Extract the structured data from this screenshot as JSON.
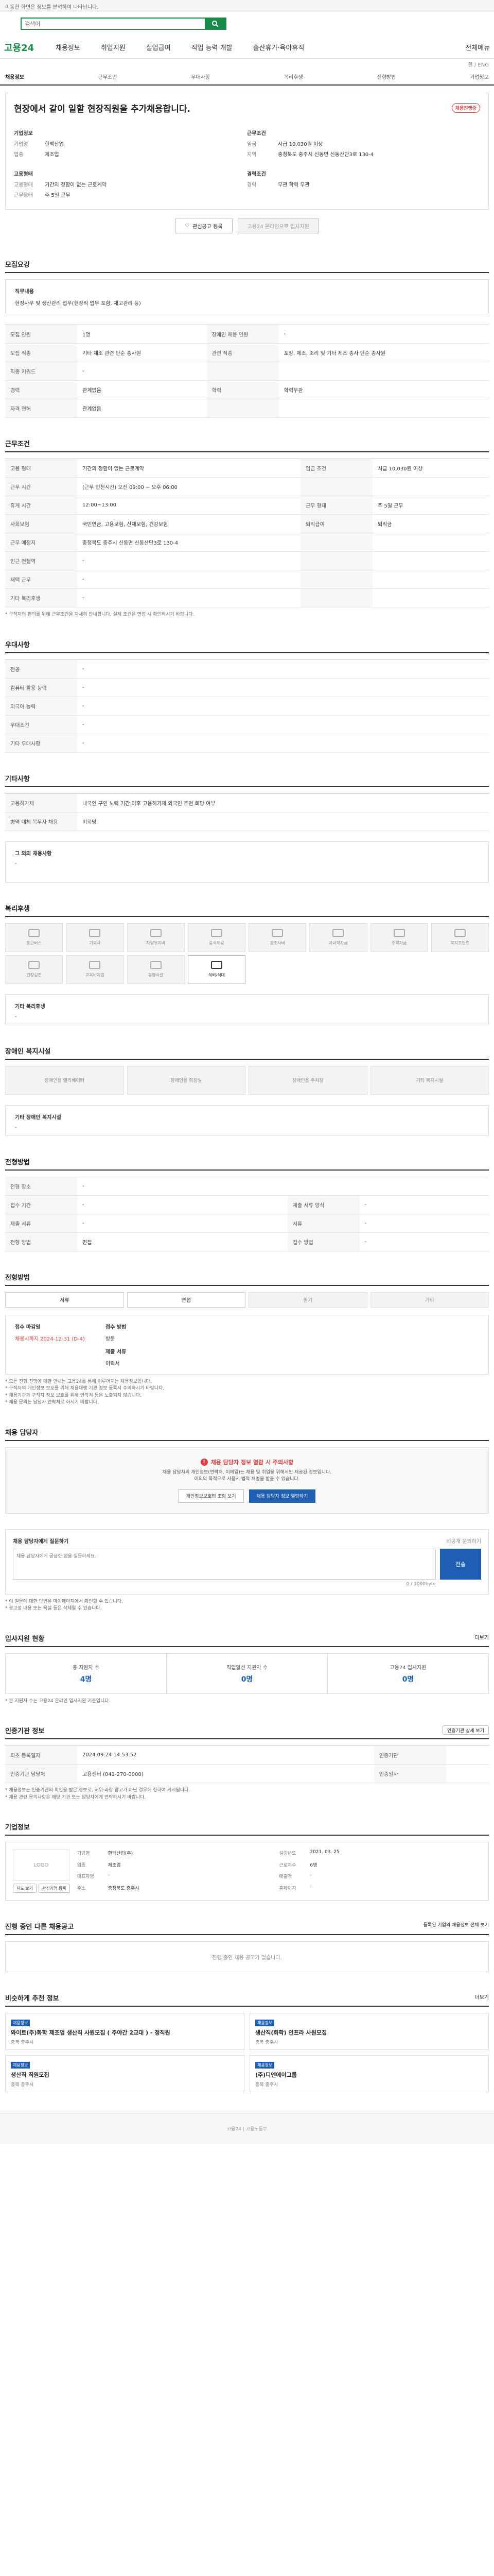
{
  "top": {
    "notice": "이동한 화면은 정보를 분석하여 나타납니다."
  },
  "search": {
    "placeholder": "검색어"
  },
  "gnb": {
    "logo": "고용24",
    "items": [
      "채용정보",
      "취업지원",
      "실업급여",
      "직업 능력 개발",
      "출산휴가·육아휴직"
    ],
    "right": "전체메뉴",
    "lang": "한 / ENG"
  },
  "subnav": [
    "채용정보",
    "근무조건",
    "우대사항",
    "복리후생",
    "전형방법",
    "기업정보"
  ],
  "header": {
    "title": "현장에서 같이 일할 현장직원을 추가채용합니다.",
    "badge": "채용진행중",
    "company_title": "기업정보",
    "company_rows": [
      {
        "k": "기업명",
        "v": "한백산업"
      },
      {
        "k": "업종",
        "v": "제조업"
      }
    ],
    "cond_title": "근무조건",
    "cond_rows": [
      {
        "k": "임금",
        "v": "시급 10,030원 이상"
      },
      {
        "k": "지역",
        "v": "충청북도 충주시 신동면 신동산단3로 130-4"
      }
    ],
    "emp_title": "고용형태",
    "emp_rows": [
      {
        "k": "고용형태",
        "v": "기간의 정함이 없는 근로계약"
      },
      {
        "k": "근무형태",
        "v": "주 5일 근무"
      }
    ],
    "career_title": "경력조건",
    "career_rows": [
      {
        "k": "경력",
        "v": "무관 학력 무관"
      }
    ],
    "btn_scrap": "관심공고 등록",
    "btn_apply": "고용24 온라인으로 입사지원"
  },
  "recruit": {
    "title": "모집요강",
    "duty_title": "직무내용",
    "duty_text": "현장사무 및 생산관리 업무(현장직 업무 포함, 재고관리 등)",
    "rows": [
      {
        "k": "모집 인원",
        "v": "1명",
        "k2": "장애인 채용 인원",
        "v2": "-"
      },
      {
        "k": "모집 직종",
        "v": "기타 제조 관련 단순 종사원",
        "k2": "관련 직종",
        "v2": "포장, 제조, 조리 및 기타 제조 종사 단순 종사원"
      },
      {
        "k": "직종 키워드",
        "v": "-",
        "k2": "",
        "v2": ""
      },
      {
        "k": "경력",
        "v": "관계없음",
        "k2": "학력",
        "v2": "학력무관"
      },
      {
        "k": "자격 면허",
        "v": "관계없음",
        "k2": "",
        "v2": ""
      }
    ]
  },
  "work": {
    "title": "근무조건",
    "rows": [
      {
        "k": "고용 형태",
        "v": "기간의 정함이 없는 근로계약",
        "k2": "임금 조건",
        "v2": "시급 10,030원 이상"
      },
      {
        "k": "근무 시간",
        "v": "(근무 인천시간) 오전 09:00 ~ 오후 06:00",
        "k2": "",
        "v2": ""
      },
      {
        "k": "휴게 시간",
        "v": "12:00~13:00",
        "k2": "근무 형태",
        "v2": "주 5일 근무"
      },
      {
        "k": "사회보험",
        "v": "국민연금, 고용보험, 산재보험, 건강보험",
        "k2": "퇴직급여",
        "v2": "퇴직금"
      },
      {
        "k": "근무 예정지",
        "v": "충청북도 충주시 신동면 신동산단3로 130-4",
        "k2": "",
        "v2": ""
      },
      {
        "k": "인근 전철역",
        "v": "-",
        "k2": "",
        "v2": ""
      },
      {
        "k": "재택 근무",
        "v": "-",
        "k2": "",
        "v2": ""
      },
      {
        "k": "기타 복리후생",
        "v": "-",
        "k2": "",
        "v2": ""
      }
    ],
    "note": "* 구직자의 편의를 위해 근무조건을 자세히 안내합니다. 실제 조건은 면접 시 확인하시기 바랍니다."
  },
  "pref": {
    "title": "우대사항",
    "rows": [
      {
        "k": "전공",
        "v": "-"
      },
      {
        "k": "컴퓨터 활용 능력",
        "v": "-"
      },
      {
        "k": "외국어 능력",
        "v": "-"
      },
      {
        "k": "우대조건",
        "v": "-"
      },
      {
        "k": "기타 우대사항",
        "v": "-"
      }
    ]
  },
  "other": {
    "title": "기타사항",
    "rows": [
      {
        "k": "고용허가제",
        "v": "내국인 구인 노력 기간 이후 고용허가제 외국인 추천 희망 여부"
      },
      {
        "k": "병역 대체 복무자 채용",
        "v": "비희망"
      }
    ],
    "sub_title": "그 외의 채용사항",
    "sub_text": "-"
  },
  "welfare": {
    "title": "복리후생",
    "items": [
      {
        "label": "통근버스",
        "on": false
      },
      {
        "label": "기숙사",
        "on": false
      },
      {
        "label": "차량유지비",
        "on": false
      },
      {
        "label": "중식제공",
        "on": false
      },
      {
        "label": "경조사비",
        "on": false
      },
      {
        "label": "자녀학자금",
        "on": false
      },
      {
        "label": "주택자금",
        "on": false
      },
      {
        "label": "복지포인트",
        "on": false
      },
      {
        "label": "건강검진",
        "on": false
      },
      {
        "label": "교육비지원",
        "on": false
      },
      {
        "label": "휴양시설",
        "on": false
      },
      {
        "label": "식비/식대",
        "on": true
      }
    ],
    "etc_title": "기타 복리후생",
    "etc_text": "-"
  },
  "disab": {
    "title": "장애인 복지시설",
    "items": [
      "장애인용 엘리베이터",
      "장애인용 화장실",
      "장애인용 주차장",
      "기타 복지시설"
    ],
    "etc_title": "기타 장애인 복지시설",
    "etc_text": "-"
  },
  "method": {
    "title": "전형방법",
    "rows": [
      {
        "k": "전형 장소",
        "v": "-"
      },
      {
        "k": "접수 기간",
        "v": "-",
        "k2": "제출 서류 양식",
        "v2": "-"
      },
      {
        "k": "제출 서류",
        "v": "-",
        "k2": "서류",
        "v2": "-"
      },
      {
        "k": "전형 방법",
        "v": "면접",
        "k2": "접수 방법",
        "v2": "-"
      }
    ]
  },
  "jeonhyeong": {
    "title": "전형방법",
    "items": [
      {
        "label": "서류",
        "off": false
      },
      {
        "label": "면접",
        "off": false
      },
      {
        "label": "필기",
        "off": true
      },
      {
        "label": "기타",
        "off": true
      }
    ],
    "deadline_title": "접수 마감일",
    "deadline": "채용시까지 2024-12-31 (D-4)",
    "apply_title": "접수 방법",
    "apply": "방문",
    "doc_title": "제출 서류",
    "doc": "이력서",
    "notes": [
      "* 모든 전형 진행에 대한 안내는 고용24를 통해 이루어지는 채용정보입니다.",
      "* 구직자의 개인정보 보호를 위해 채용대행 기관 정보 등록시 주의하시기 바랍니다.",
      "* 채용기관과 구직자 정보 보호를 위해 연락처 등은 노출되지 않습니다.",
      "* 채용 문의는 담당자 연락처로 하시기 바랍니다."
    ]
  },
  "contact": {
    "title": "채용 담당자",
    "alert": "채용 담당자 정보 열람 시 주의사항",
    "desc1": "채용 담당자의 개인정보(연락처, 이메일)는 채용 및 취업을 위해서만 제공된 정보입니다.",
    "desc2": "이외의 목적으로 사용시 법적 처벌을 받을 수 있습니다.",
    "btn1": "개인정보보호법 조항 보기",
    "btn2": "채용 담당자 정보 열람하기"
  },
  "inquiry": {
    "title": "채용 담당자에게 질문하기",
    "hint": "비공개 문의하기",
    "placeholder": "채용 담당자에게 궁금한 점을 질문하세요.",
    "send": "전송",
    "count": "0 / 1000byte",
    "notes": [
      "* 이 질문에 대한 답변은 마이페이지에서 확인할 수 있습니다.",
      "* 광고성 내용 또는 욕설 등은 삭제될 수 있습니다."
    ]
  },
  "status": {
    "title": "입사지원 현황",
    "more": "더보기",
    "items": [
      {
        "l": "총 지원자 수",
        "v": "4명"
      },
      {
        "l": "직업알선 지원자 수",
        "v": "0명"
      },
      {
        "l": "고용24 입사지원",
        "v": "0명"
      }
    ],
    "note": "* 본 지원자 수는 고용24 온라인 입사지원 기준입니다."
  },
  "agency": {
    "title": "인증기관 정보",
    "btn": "인증기관 상세 보기",
    "rows": [
      {
        "k": "최초 등록일자",
        "v": "2024.09.24 14:53:52",
        "k2": "인증기관",
        "v2": "",
        "k3": "",
        "v3": ""
      },
      {
        "k": "인증기관 담당처",
        "v": "고용센터 (041-270-0000)",
        "k2": "인증일자",
        "v2": "",
        "k3": "",
        "v3": ""
      }
    ],
    "notes": [
      "* 채용정보는 인증기관의 확인을 받은 정보로, 허위·과장 광고가 아닌 경우에 한하여 게시됩니다.",
      "* 채용 관련 문의사항은 해당 기관 또는 담당자에게 연락하시기 바랍니다."
    ]
  },
  "company": {
    "title": "기업정보",
    "logo": "LOGO",
    "btn1": "지도 보기",
    "btn2": "관심기업 등록",
    "fields": [
      {
        "k": "기업명",
        "v": "한백산업(주)"
      },
      {
        "k": "설립년도",
        "v": "2021. 03. 25"
      },
      {
        "k": "업종",
        "v": "제조업"
      },
      {
        "k": "근로자수",
        "v": "6명"
      },
      {
        "k": "대표자명",
        "v": "-"
      },
      {
        "k": "매출액",
        "v": "-"
      },
      {
        "k": "주소",
        "v": "충청북도 충주시"
      },
      {
        "k": "홈페이지",
        "v": "-"
      }
    ]
  },
  "others": {
    "title": "진행 중인 다른 채용공고",
    "more": "등록된 기업의 채용정보 전체 보기",
    "empty": "진행 중인 채용 공고가 없습니다."
  },
  "rec": {
    "title": "비슷하게 추천 정보",
    "more": "더보기",
    "cards": [
      {
        "tag": "채용정보",
        "title": "와이트(주)화학 제조업 생산직 사원모집 ( 주야간 2교대 ) - 정직원",
        "meta": "충북 충주시"
      },
      {
        "tag": "채용정보",
        "title": "생산직(화학) 인프라 사원모집",
        "meta": "충북 충주시"
      },
      {
        "tag": "채용정보",
        "title": "생산직 직원모집",
        "meta": "충북 충주시"
      },
      {
        "tag": "채용정보",
        "title": "(주)디엔에이그룹",
        "meta": "충북 충주시"
      }
    ]
  },
  "footer": "고용24 | 고용노동부"
}
